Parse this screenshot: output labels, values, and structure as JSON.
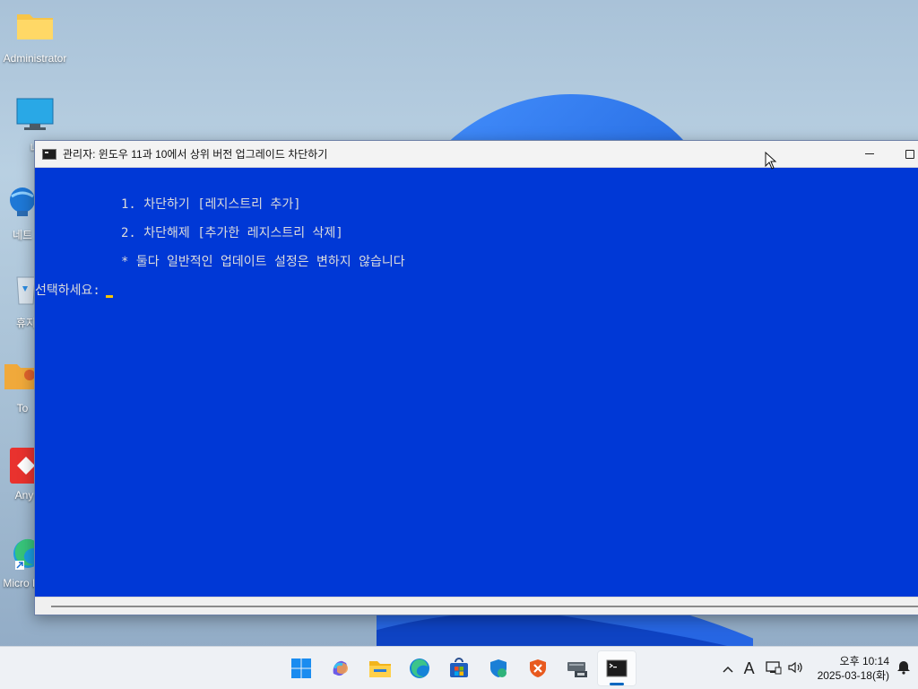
{
  "desktop": {
    "icons": [
      {
        "label": "Administrator"
      },
      {
        "label": "내"
      },
      {
        "label": "네트"
      },
      {
        "label": "휴지"
      },
      {
        "label": "To"
      },
      {
        "label": "Any"
      },
      {
        "label": "Micro Ed"
      }
    ]
  },
  "window": {
    "title": "관리자:  윈도우 11과 10에서 상위 버전 업그레이드 차단하기",
    "minimize_icon": "minimize-icon",
    "maximize_icon": "maximize-icon"
  },
  "console": {
    "line1": "1. 차단하기 [레지스트리 추가]",
    "line2": "2. 차단해제 [추가한 레지스트리 삭제]",
    "line3": "* 둘다 일반적인 업데이트 설정은 변하지 않습니다",
    "prompt": "선택하세요:",
    "input_value": "",
    "cursor_color": "#f5c400",
    "background_color": "#0038d6"
  },
  "taskbar": {
    "apps": [
      "start-icon",
      "copilot-icon",
      "file-explorer-icon",
      "edge-icon",
      "store-icon",
      "security-icon",
      "antivirus-icon",
      "network-drive-icon",
      "terminal-icon"
    ],
    "tray": {
      "overflow": "^",
      "ime": "A",
      "clock_time": "오후 10:14",
      "clock_date": "2025-03-18(화)"
    }
  }
}
